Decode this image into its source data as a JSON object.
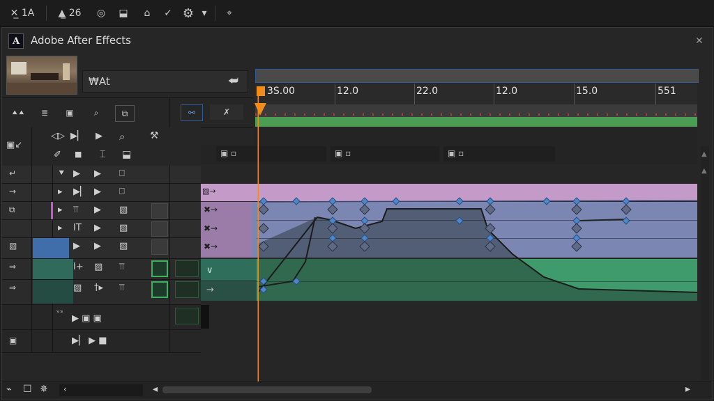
{
  "toolbar": {
    "items": [
      {
        "label": "✕̲ 1A",
        "icon": "selection-tool-icon"
      },
      {
        "label": "▲̲ 26",
        "icon": "layer-tool-icon"
      },
      {
        "label": "◎",
        "icon": "orbit-tool-icon"
      },
      {
        "label": "⬓",
        "icon": "export-icon"
      },
      {
        "label": "⌂",
        "icon": "home-icon"
      },
      {
        "label": "✓",
        "icon": "check-icon"
      },
      {
        "label": "⚙",
        "icon": "gear-icon"
      },
      {
        "label": "▾",
        "icon": "chevron-down-icon"
      },
      {
        "label": "⌖",
        "icon": "grid-icon"
      }
    ]
  },
  "panel": {
    "logo_letter": "A",
    "title": "Adobe After Effects",
    "close": "✕"
  },
  "comp": {
    "name": "₩At",
    "collapse": "⮨"
  },
  "ruler": {
    "labels": [
      "3S.00",
      "12.0",
      "22.0",
      "12.0",
      "15.0",
      "551"
    ]
  },
  "tools_row1": [
    "⯅⯅",
    "≣",
    "▣",
    "⌕",
    "⧉"
  ],
  "tools_row1_right": [
    "⚯",
    "✗"
  ],
  "panel_controls": {
    "left": "▣↙",
    "row_a": [
      "◁▷",
      "▶▏",
      "▶",
      "⌕",
      "⚒"
    ],
    "row_b": [
      "✐",
      "■",
      "⌶",
      "⬓"
    ]
  },
  "layer_fields": [
    "▣ ▫",
    "▣ ▫",
    "▣ ▫"
  ],
  "layers": [
    {
      "id": 1,
      "switch_icon": "↵",
      "cols": [
        "⯆",
        "▶",
        "▶",
        "⎕"
      ],
      "track": "pink",
      "tag": "▨→"
    },
    {
      "id": 2,
      "switch_icon": "→",
      "cols": [
        "▸",
        "▶▏",
        "▶",
        "⎕"
      ],
      "track": "pink",
      "tag": "▨→"
    },
    {
      "id": 3,
      "switch_icon": "⧉",
      "cols": [
        "▸",
        "⫪",
        "▶",
        "▧"
      ],
      "track": "blue",
      "tag": "✖→"
    },
    {
      "id": 4,
      "switch_icon": "",
      "cols": [
        "▸",
        "IT",
        "▶",
        "▧"
      ],
      "track": "blue",
      "tag": "✖→"
    },
    {
      "id": 5,
      "switch_icon": "▧",
      "cols": [
        "⫪",
        "▶",
        "▶",
        "▧"
      ],
      "track": "blue",
      "tag": "✖→"
    },
    {
      "id": 6,
      "switch_icon": "⇒",
      "cols": [
        "☐",
        "I+",
        "▨",
        "⫪"
      ],
      "track": "green",
      "tag": "∨"
    },
    {
      "id": 7,
      "switch_icon": "⇒",
      "cols": [
        "I+",
        "▨",
        "†▸",
        "⫪"
      ],
      "track": "green",
      "tag": "→"
    }
  ],
  "row8_label": "ᵛˢ",
  "bottom": {
    "icons": [
      "⌁",
      "☐",
      "✵"
    ],
    "field_text": "‹",
    "scroll_left": "◂",
    "scroll_right": "▸"
  },
  "colors": {
    "pink": "#c49bc8",
    "blue": "#7b86b3",
    "green": "#3f9a6c",
    "playhead": "#f08c1a",
    "keyframe": "#4f86c8"
  }
}
